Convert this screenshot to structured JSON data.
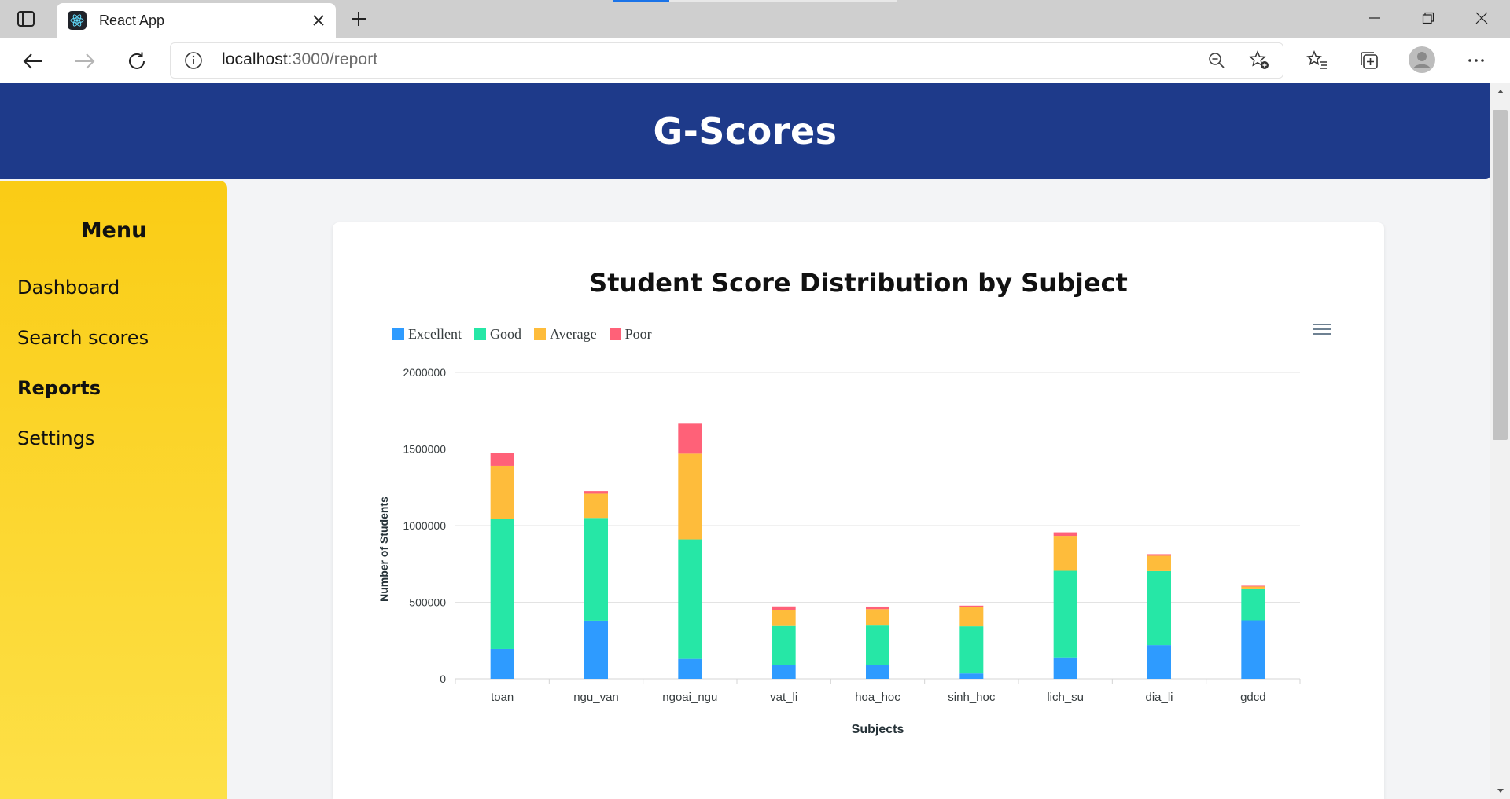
{
  "browser": {
    "tab_title": "React App",
    "url_host": "localhost",
    "url_path": ":3000/report"
  },
  "app": {
    "title": "G-Scores"
  },
  "sidebar": {
    "title": "Menu",
    "items": [
      {
        "label": "Dashboard",
        "active": false
      },
      {
        "label": "Search scores",
        "active": false
      },
      {
        "label": "Reports",
        "active": true
      },
      {
        "label": "Settings",
        "active": false
      }
    ]
  },
  "chart_data": {
    "type": "bar",
    "stacked": true,
    "title": "Student Score Distribution by Subject",
    "xlabel": "Subjects",
    "ylabel": "Number of Students",
    "ylim": [
      0,
      2000000
    ],
    "yticks": [
      "0",
      "500000",
      "1000000",
      "1500000",
      "2000000"
    ],
    "grid": true,
    "legend_position": "top-left",
    "categories": [
      "toan",
      "ngu_van",
      "ngoai_ngu",
      "vat_li",
      "hoa_hoc",
      "sinh_hoc",
      "lich_su",
      "dia_li",
      "gdcd"
    ],
    "series": [
      {
        "name": "Excellent",
        "color": "#2e9bff",
        "values": [
          195000,
          380000,
          130000,
          92000,
          90000,
          35000,
          140000,
          220000,
          382000
        ]
      },
      {
        "name": "Good",
        "color": "#26e7a6",
        "values": [
          850000,
          670000,
          780000,
          253000,
          258000,
          308000,
          565000,
          483000,
          203000
        ]
      },
      {
        "name": "Average",
        "color": "#febc3b",
        "values": [
          345000,
          158000,
          560000,
          103000,
          107000,
          125000,
          228000,
          100000,
          18000
        ]
      },
      {
        "name": "Poor",
        "color": "#ff6178",
        "values": [
          82000,
          17000,
          195000,
          25000,
          17000,
          10000,
          23000,
          10000,
          5000
        ]
      }
    ]
  }
}
